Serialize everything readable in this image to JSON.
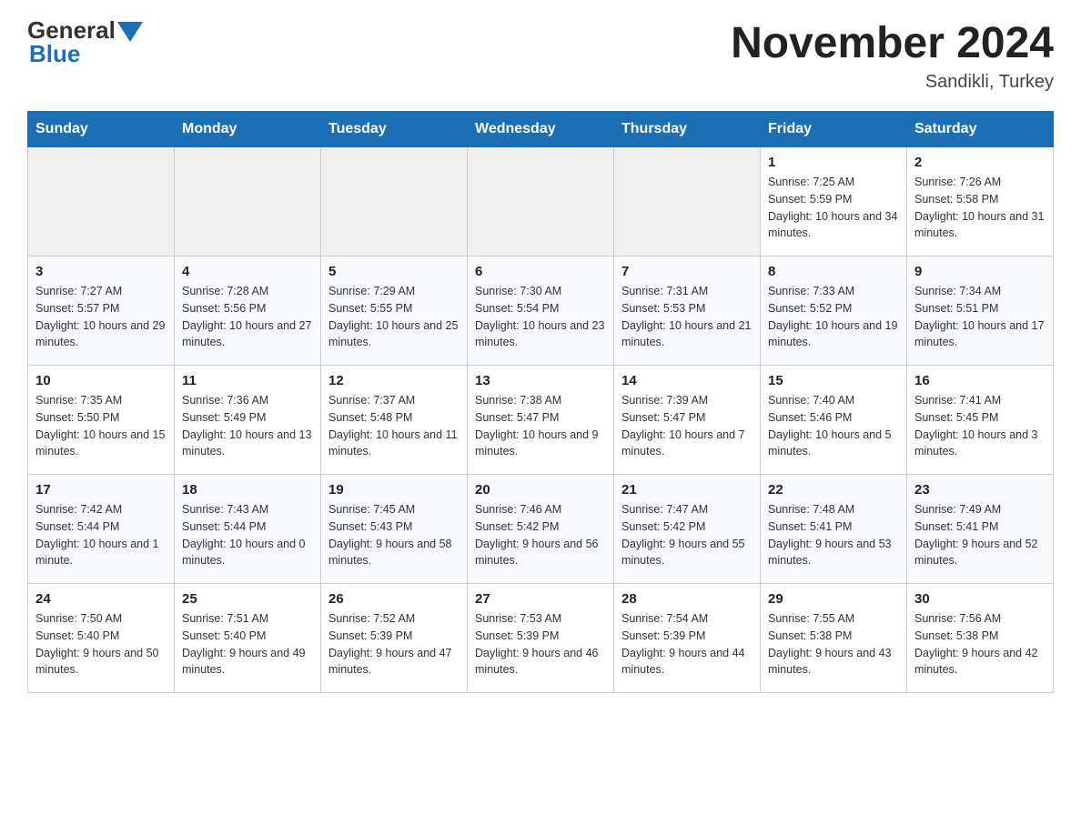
{
  "header": {
    "logo_general": "General",
    "logo_blue": "Blue",
    "month_title": "November 2024",
    "location": "Sandikli, Turkey"
  },
  "days_of_week": [
    "Sunday",
    "Monday",
    "Tuesday",
    "Wednesday",
    "Thursday",
    "Friday",
    "Saturday"
  ],
  "weeks": [
    [
      {
        "day": "",
        "sunrise": "",
        "sunset": "",
        "daylight": ""
      },
      {
        "day": "",
        "sunrise": "",
        "sunset": "",
        "daylight": ""
      },
      {
        "day": "",
        "sunrise": "",
        "sunset": "",
        "daylight": ""
      },
      {
        "day": "",
        "sunrise": "",
        "sunset": "",
        "daylight": ""
      },
      {
        "day": "",
        "sunrise": "",
        "sunset": "",
        "daylight": ""
      },
      {
        "day": "1",
        "sunrise": "Sunrise: 7:25 AM",
        "sunset": "Sunset: 5:59 PM",
        "daylight": "Daylight: 10 hours and 34 minutes."
      },
      {
        "day": "2",
        "sunrise": "Sunrise: 7:26 AM",
        "sunset": "Sunset: 5:58 PM",
        "daylight": "Daylight: 10 hours and 31 minutes."
      }
    ],
    [
      {
        "day": "3",
        "sunrise": "Sunrise: 7:27 AM",
        "sunset": "Sunset: 5:57 PM",
        "daylight": "Daylight: 10 hours and 29 minutes."
      },
      {
        "day": "4",
        "sunrise": "Sunrise: 7:28 AM",
        "sunset": "Sunset: 5:56 PM",
        "daylight": "Daylight: 10 hours and 27 minutes."
      },
      {
        "day": "5",
        "sunrise": "Sunrise: 7:29 AM",
        "sunset": "Sunset: 5:55 PM",
        "daylight": "Daylight: 10 hours and 25 minutes."
      },
      {
        "day": "6",
        "sunrise": "Sunrise: 7:30 AM",
        "sunset": "Sunset: 5:54 PM",
        "daylight": "Daylight: 10 hours and 23 minutes."
      },
      {
        "day": "7",
        "sunrise": "Sunrise: 7:31 AM",
        "sunset": "Sunset: 5:53 PM",
        "daylight": "Daylight: 10 hours and 21 minutes."
      },
      {
        "day": "8",
        "sunrise": "Sunrise: 7:33 AM",
        "sunset": "Sunset: 5:52 PM",
        "daylight": "Daylight: 10 hours and 19 minutes."
      },
      {
        "day": "9",
        "sunrise": "Sunrise: 7:34 AM",
        "sunset": "Sunset: 5:51 PM",
        "daylight": "Daylight: 10 hours and 17 minutes."
      }
    ],
    [
      {
        "day": "10",
        "sunrise": "Sunrise: 7:35 AM",
        "sunset": "Sunset: 5:50 PM",
        "daylight": "Daylight: 10 hours and 15 minutes."
      },
      {
        "day": "11",
        "sunrise": "Sunrise: 7:36 AM",
        "sunset": "Sunset: 5:49 PM",
        "daylight": "Daylight: 10 hours and 13 minutes."
      },
      {
        "day": "12",
        "sunrise": "Sunrise: 7:37 AM",
        "sunset": "Sunset: 5:48 PM",
        "daylight": "Daylight: 10 hours and 11 minutes."
      },
      {
        "day": "13",
        "sunrise": "Sunrise: 7:38 AM",
        "sunset": "Sunset: 5:47 PM",
        "daylight": "Daylight: 10 hours and 9 minutes."
      },
      {
        "day": "14",
        "sunrise": "Sunrise: 7:39 AM",
        "sunset": "Sunset: 5:47 PM",
        "daylight": "Daylight: 10 hours and 7 minutes."
      },
      {
        "day": "15",
        "sunrise": "Sunrise: 7:40 AM",
        "sunset": "Sunset: 5:46 PM",
        "daylight": "Daylight: 10 hours and 5 minutes."
      },
      {
        "day": "16",
        "sunrise": "Sunrise: 7:41 AM",
        "sunset": "Sunset: 5:45 PM",
        "daylight": "Daylight: 10 hours and 3 minutes."
      }
    ],
    [
      {
        "day": "17",
        "sunrise": "Sunrise: 7:42 AM",
        "sunset": "Sunset: 5:44 PM",
        "daylight": "Daylight: 10 hours and 1 minute."
      },
      {
        "day": "18",
        "sunrise": "Sunrise: 7:43 AM",
        "sunset": "Sunset: 5:44 PM",
        "daylight": "Daylight: 10 hours and 0 minutes."
      },
      {
        "day": "19",
        "sunrise": "Sunrise: 7:45 AM",
        "sunset": "Sunset: 5:43 PM",
        "daylight": "Daylight: 9 hours and 58 minutes."
      },
      {
        "day": "20",
        "sunrise": "Sunrise: 7:46 AM",
        "sunset": "Sunset: 5:42 PM",
        "daylight": "Daylight: 9 hours and 56 minutes."
      },
      {
        "day": "21",
        "sunrise": "Sunrise: 7:47 AM",
        "sunset": "Sunset: 5:42 PM",
        "daylight": "Daylight: 9 hours and 55 minutes."
      },
      {
        "day": "22",
        "sunrise": "Sunrise: 7:48 AM",
        "sunset": "Sunset: 5:41 PM",
        "daylight": "Daylight: 9 hours and 53 minutes."
      },
      {
        "day": "23",
        "sunrise": "Sunrise: 7:49 AM",
        "sunset": "Sunset: 5:41 PM",
        "daylight": "Daylight: 9 hours and 52 minutes."
      }
    ],
    [
      {
        "day": "24",
        "sunrise": "Sunrise: 7:50 AM",
        "sunset": "Sunset: 5:40 PM",
        "daylight": "Daylight: 9 hours and 50 minutes."
      },
      {
        "day": "25",
        "sunrise": "Sunrise: 7:51 AM",
        "sunset": "Sunset: 5:40 PM",
        "daylight": "Daylight: 9 hours and 49 minutes."
      },
      {
        "day": "26",
        "sunrise": "Sunrise: 7:52 AM",
        "sunset": "Sunset: 5:39 PM",
        "daylight": "Daylight: 9 hours and 47 minutes."
      },
      {
        "day": "27",
        "sunrise": "Sunrise: 7:53 AM",
        "sunset": "Sunset: 5:39 PM",
        "daylight": "Daylight: 9 hours and 46 minutes."
      },
      {
        "day": "28",
        "sunrise": "Sunrise: 7:54 AM",
        "sunset": "Sunset: 5:39 PM",
        "daylight": "Daylight: 9 hours and 44 minutes."
      },
      {
        "day": "29",
        "sunrise": "Sunrise: 7:55 AM",
        "sunset": "Sunset: 5:38 PM",
        "daylight": "Daylight: 9 hours and 43 minutes."
      },
      {
        "day": "30",
        "sunrise": "Sunrise: 7:56 AM",
        "sunset": "Sunset: 5:38 PM",
        "daylight": "Daylight: 9 hours and 42 minutes."
      }
    ]
  ]
}
